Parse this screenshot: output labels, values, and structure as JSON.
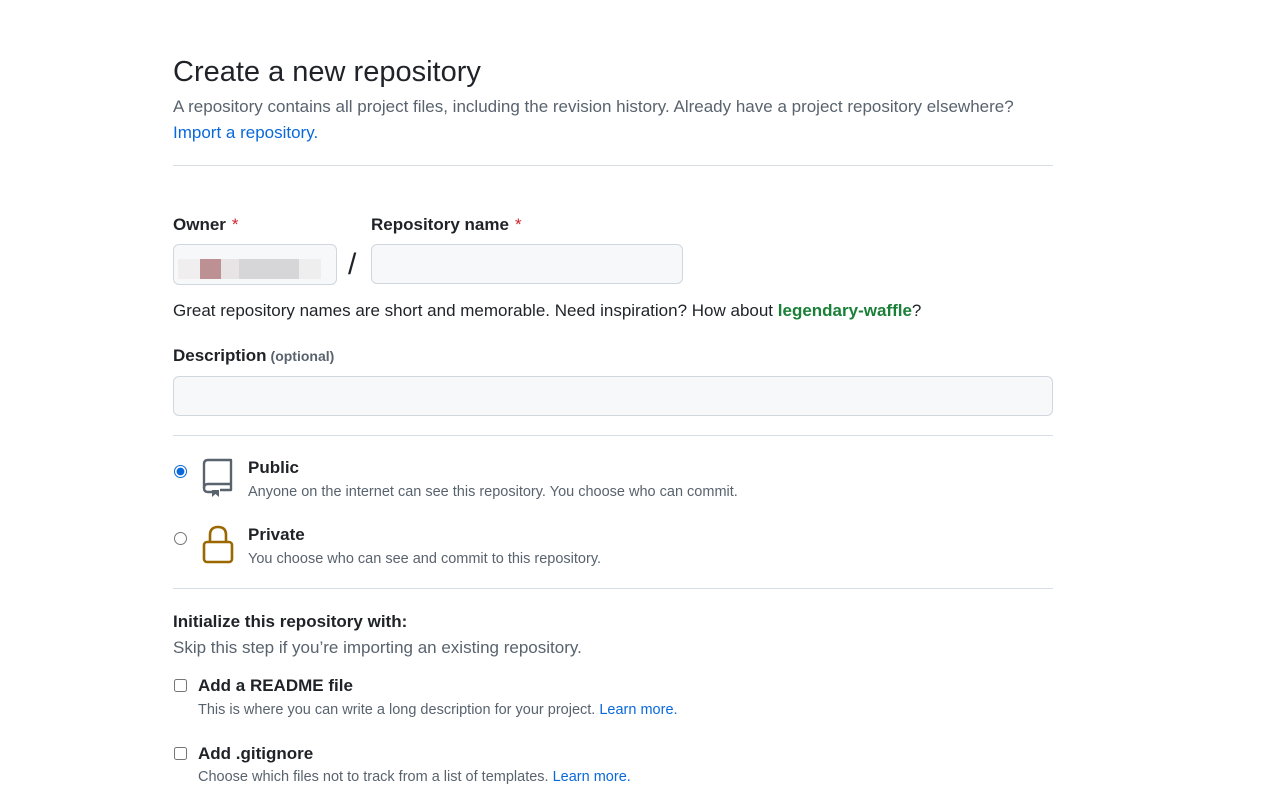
{
  "header": {
    "title": "Create a new repository",
    "subtitle": "A repository contains all project files, including the revision history. Already have a project repository elsewhere?",
    "import_link": "Import a repository."
  },
  "owner": {
    "label": "Owner",
    "required_mark": "*"
  },
  "repo_name": {
    "label": "Repository name",
    "required_mark": "*",
    "value": ""
  },
  "separator": "/",
  "hint": {
    "prefix": "Great repository names are short and memorable. Need inspiration? How about ",
    "suggestion": "legendary-waffle",
    "suffix": "?"
  },
  "description": {
    "label": "Description",
    "optional": "(optional)",
    "value": ""
  },
  "visibility": {
    "selected": "public",
    "public": {
      "title": "Public",
      "desc": "Anyone on the internet can see this repository. You choose who can commit.",
      "icon": "repo-icon"
    },
    "private": {
      "title": "Private",
      "desc": "You choose who can see and commit to this repository.",
      "icon": "lock-icon"
    }
  },
  "init": {
    "title": "Initialize this repository with:",
    "subtitle": "Skip this step if you’re importing an existing repository.",
    "readme": {
      "label": "Add a README file",
      "desc": "This is where you can write a long description for your project.",
      "learn": "Learn more."
    },
    "gitignore": {
      "label": "Add .gitignore",
      "desc": "Choose which files not to track from a list of templates.",
      "learn": "Learn more."
    }
  },
  "colors": {
    "link": "#0969da",
    "required": "#cf222e",
    "suggestion": "#1a7f37",
    "lock": "#9a6700"
  }
}
